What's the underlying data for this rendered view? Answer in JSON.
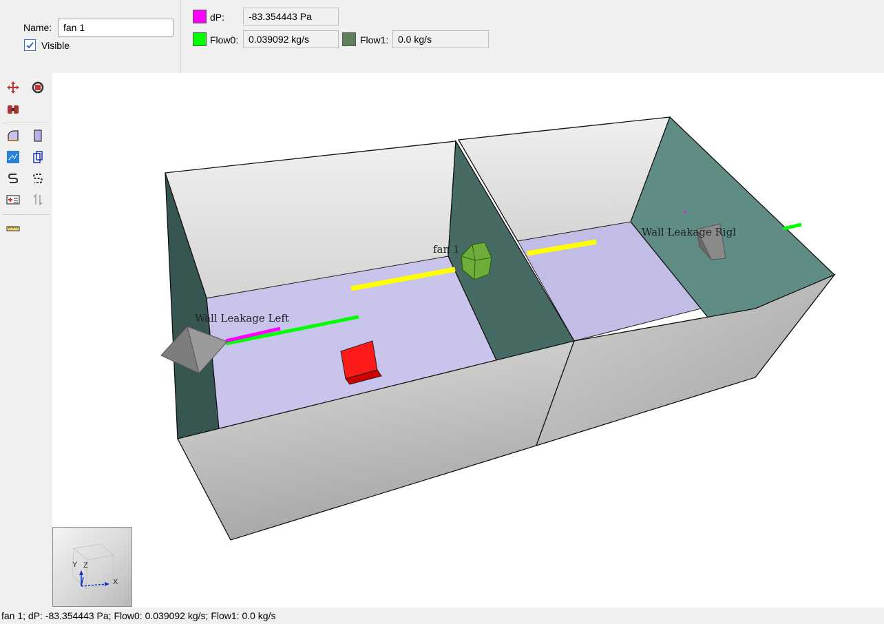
{
  "properties": {
    "name_label": "Name:",
    "name_value": "fan 1",
    "visible_label": "Visible",
    "visible_checked": true
  },
  "readouts": {
    "dp_label": "dP:",
    "dp_value": "-83.354443 Pa",
    "dp_color": "#ff00ff",
    "flow0_label": "Flow0:",
    "flow0_value": "0.039092 kg/s",
    "flow0_color": "#00ff00",
    "flow1_label": "Flow1:",
    "flow1_value": "0.0 kg/s",
    "flow1_color": "#5f7f5f"
  },
  "toolbar": {
    "icons": [
      "move-icon",
      "rotate-icon",
      "group-icon",
      "zone-icon",
      "wall-panel-icon",
      "toggle-transparency-icon",
      "copy-icon",
      "path-icon",
      "path-alt-icon",
      "add-item-icon",
      "flip-icon",
      "ruler-icon"
    ]
  },
  "scene": {
    "labels": {
      "fan": "fan 1",
      "leak_left": "Wall Leakage Left",
      "leak_right": "Wall Leakage Rigl"
    },
    "colors": {
      "floor": "#c9c4ec",
      "side_wall": "#3f5f5a",
      "outer_wall": "#c4c4c4",
      "back_wall": "#e6e6e6",
      "fan": "#6dae3a",
      "box": "#ff1a1a",
      "flow_yellow": "#ffff00",
      "flow_green": "#00ff00",
      "flow_magenta": "#ff00ff"
    }
  },
  "navigator": {
    "axis_x": "X",
    "axis_y": "Y",
    "axis_z": "Z"
  },
  "status_text": "fan 1; dP: -83.354443 Pa; Flow0: 0.039092 kg/s; Flow1: 0.0 kg/s"
}
